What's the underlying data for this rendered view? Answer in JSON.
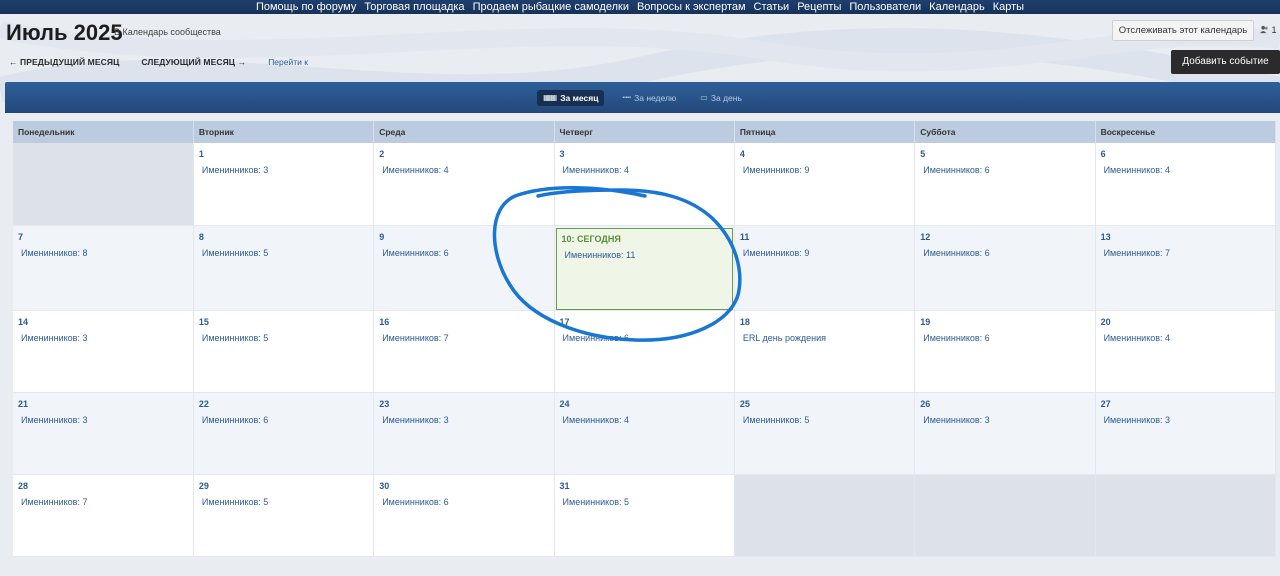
{
  "topnav": {
    "items": [
      "Помощь по форуму",
      "Торговая площадка",
      "Продаем рыбацкие самоделки",
      "Вопросы к экспертам",
      "Статьи",
      "Рецепты",
      "Пользователи",
      "Календарь",
      "Карты"
    ]
  },
  "header": {
    "title": "Июль 2025",
    "breadcrumb": "В Календарь сообщества",
    "follow_label": "Отслеживать этот календарь",
    "user_count": "1",
    "prev_label": "← ПРЕДЫДУЩИЙ МЕСЯЦ",
    "next_label": "СЛЕДУЮЩИЙ МЕСЯЦ →",
    "goto_label": "Перейти к",
    "add_event_label": "Добавить событие"
  },
  "views": {
    "month": "За месяц",
    "week": "За неделю",
    "day": "За день"
  },
  "calendar": {
    "weekdays": [
      "Понедельник",
      "Вторник",
      "Среда",
      "Четверг",
      "Пятница",
      "Суббота",
      "Воскресенье"
    ],
    "today_label": "СЕГОДНЯ",
    "weeks": [
      [
        null,
        {
          "day": "1",
          "event": "Именинников: 3"
        },
        {
          "day": "2",
          "event": "Именинников: 4"
        },
        {
          "day": "3",
          "event": "Именинников: 4"
        },
        {
          "day": "4",
          "event": "Именинников: 9"
        },
        {
          "day": "5",
          "event": "Именинников: 6"
        },
        {
          "day": "6",
          "event": "Именинников: 4"
        }
      ],
      [
        {
          "day": "7",
          "event": "Именинников: 8"
        },
        {
          "day": "8",
          "event": "Именинников: 5"
        },
        {
          "day": "9",
          "event": "Именинников: 6"
        },
        {
          "day": "10",
          "event": "Именинников: 11",
          "today": true
        },
        {
          "day": "11",
          "event": "Именинников: 9"
        },
        {
          "day": "12",
          "event": "Именинников: 6"
        },
        {
          "day": "13",
          "event": "Именинников: 7"
        }
      ],
      [
        {
          "day": "14",
          "event": "Именинников: 3"
        },
        {
          "day": "15",
          "event": "Именинников: 5"
        },
        {
          "day": "16",
          "event": "Именинников: 7"
        },
        {
          "day": "17",
          "event": "Именинников: 6"
        },
        {
          "day": "18",
          "event": "ERL день рождения"
        },
        {
          "day": "19",
          "event": "Именинников: 6"
        },
        {
          "day": "20",
          "event": "Именинников: 4"
        }
      ],
      [
        {
          "day": "21",
          "event": "Именинников: 3"
        },
        {
          "day": "22",
          "event": "Именинников: 6"
        },
        {
          "day": "23",
          "event": "Именинников: 3"
        },
        {
          "day": "24",
          "event": "Именинников: 4"
        },
        {
          "day": "25",
          "event": "Именинников: 5"
        },
        {
          "day": "26",
          "event": "Именинников: 3"
        },
        {
          "day": "27",
          "event": "Именинников: 3"
        }
      ],
      [
        {
          "day": "28",
          "event": "Именинников: 7"
        },
        {
          "day": "29",
          "event": "Именинников: 5"
        },
        {
          "day": "30",
          "event": "Именинников: 6"
        },
        {
          "day": "31",
          "event": "Именинников: 5"
        },
        null,
        null,
        null
      ]
    ]
  },
  "colors": {
    "nav_bg": "#1f3f6f",
    "view_bar": "#2e5f98",
    "link": "#2c5b93",
    "today_bg": "#eff6e8",
    "today_border": "#6a9a4d",
    "annotation": "#1976d2"
  }
}
